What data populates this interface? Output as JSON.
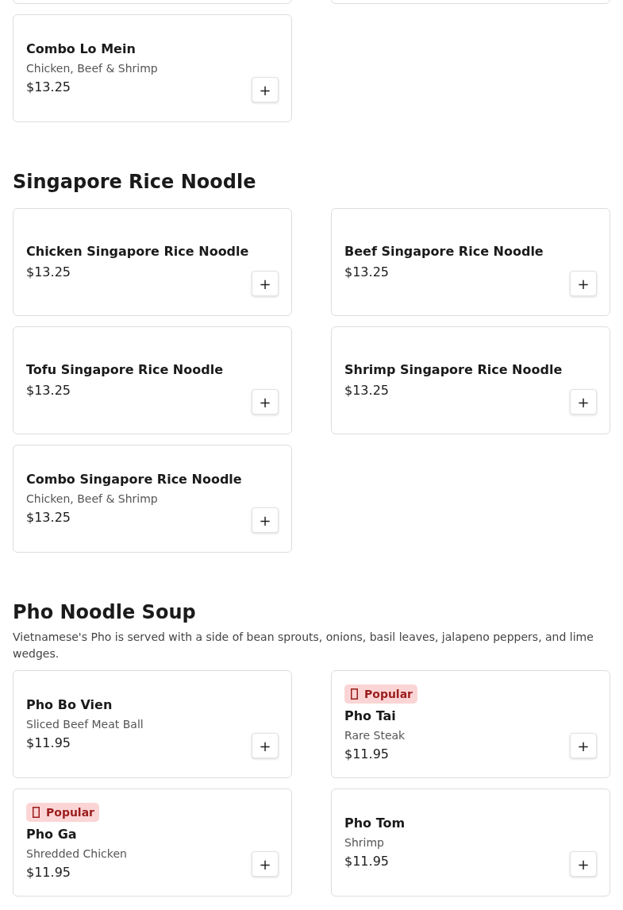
{
  "sections": [
    {
      "items": [
        {
          "kind": "cut"
        },
        {
          "kind": "cut"
        },
        {
          "kind": "dish",
          "name": "Combo Lo Mein",
          "description": "Chicken, Beef & Shrimp",
          "price": "$13.25",
          "add": "+"
        }
      ]
    },
    {
      "title": "Singapore Rice Noodle",
      "items": [
        {
          "kind": "dish",
          "name": "Chicken Singapore Rice Noodle",
          "price": "$13.25",
          "add": "+"
        },
        {
          "kind": "dish",
          "name": "Beef Singapore Rice Noodle",
          "price": "$13.25",
          "add": "+"
        },
        {
          "kind": "dish",
          "name": "Tofu Singapore Rice Noodle",
          "price": "$13.25",
          "add": "+"
        },
        {
          "kind": "dish",
          "name": "Shrimp Singapore Rice Noodle",
          "price": "$13.25",
          "add": "+"
        },
        {
          "kind": "dish",
          "name": "Combo Singapore Rice Noodle",
          "description": "Chicken, Beef & Shrimp",
          "price": "$13.25",
          "add": "+"
        }
      ]
    },
    {
      "title": "Pho Noodle Soup",
      "note": "Vietnamese's Pho is served with a side of bean sprouts, onions, basil leaves, jalapeno peppers, and lime wedges.",
      "items": [
        {
          "kind": "dish",
          "name": "Pho Bo Vien",
          "description": "Sliced Beef Meat Ball",
          "price": "$11.95",
          "add": "+"
        },
        {
          "kind": "dish",
          "badge": "Popular",
          "name": "Pho Tai",
          "description": "Rare Steak",
          "price": "$11.95",
          "add": "+"
        },
        {
          "kind": "dish",
          "badge": "Popular",
          "name": "Pho Ga",
          "description": "Shredded Chicken",
          "price": "$11.95",
          "add": "+"
        },
        {
          "kind": "dish",
          "name": "Pho Tom",
          "description": "Shrimp",
          "price": "$11.95",
          "add": "+"
        }
      ]
    }
  ]
}
